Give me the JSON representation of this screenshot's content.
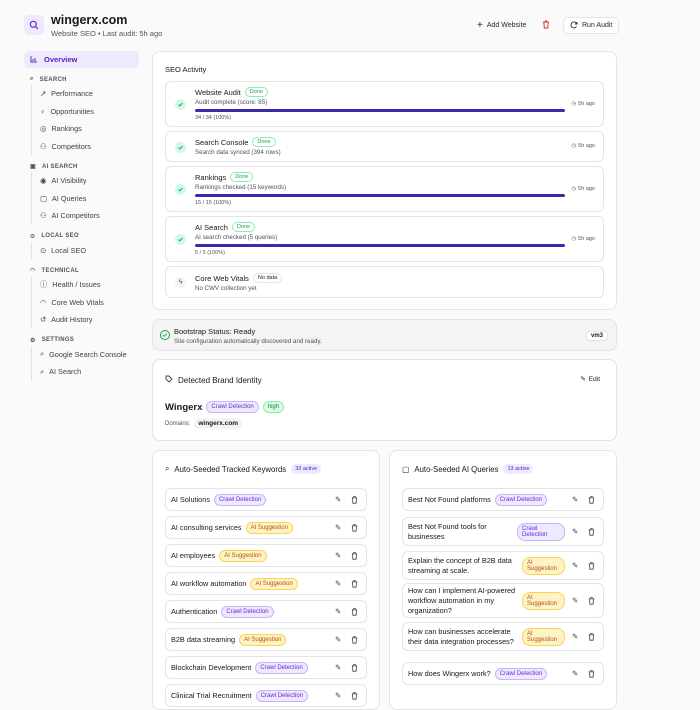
{
  "header": {
    "site": "wingerx.com",
    "subtitle": "Website SEO  • Last audit: 5h ago",
    "add_website": "Add Website",
    "run_audit": "Run Audit"
  },
  "sidebar": {
    "overview": "Overview",
    "sections": [
      {
        "title": "SEARCH",
        "items": [
          "Performance",
          "Opportunities",
          "Rankings",
          "Competitors"
        ]
      },
      {
        "title": "AI SEARCH",
        "items": [
          "AI Visibility",
          "AI Queries",
          "AI Competitors"
        ]
      },
      {
        "title": "LOCAL SEO",
        "items": [
          "Local SEO"
        ]
      },
      {
        "title": "TECHNICAL",
        "items": [
          "Health / Issues",
          "Core Web Vitals",
          "Audit History"
        ]
      },
      {
        "title": "SETTINGS",
        "items": [
          "Google Search Console",
          "AI Search"
        ]
      }
    ]
  },
  "activity": {
    "title": "SEO Activity",
    "items": [
      {
        "name": "Website Audit",
        "status": "Done",
        "desc": "Audit complete (score: 85)",
        "count": "34 / 34 (100%)",
        "time": "5h ago",
        "progress": 1.0
      },
      {
        "name": "Search Console",
        "status": "Done",
        "desc": "Search data synced (394 rows)",
        "time": "5h ago"
      },
      {
        "name": "Rankings",
        "status": "Done",
        "desc": "Rankings checked (15 keywords)",
        "count": "15 / 15 (100%)",
        "time": "5h ago",
        "progress": 1.0
      },
      {
        "name": "AI Search",
        "status": "Done",
        "desc": "AI search checked (5 queries)",
        "count": "5 / 5 (100%)",
        "time": "5h ago",
        "progress": 1.0
      },
      {
        "name": "Core Web Vitals",
        "status": "No data",
        "desc": "No CWV collection yet"
      }
    ]
  },
  "bootstrap": {
    "title": "Bootstrap Status: Ready",
    "desc": "Site configuration automatically discovered and ready.",
    "badge": "vm3"
  },
  "brand": {
    "title": "Detected Brand Identity",
    "edit": "Edit",
    "name": "Wingerx",
    "tag1": "Crawl Detection",
    "tag2": "high",
    "domains_label": "Domains:",
    "domain": "wingerx.com"
  },
  "keywords": {
    "title": "Auto-Seeded Tracked Keywords",
    "count": "33 active",
    "items": [
      {
        "text": "AI Solutions",
        "tag": "Crawl Detection"
      },
      {
        "text": "AI consulting services",
        "tag": "AI Suggestion"
      },
      {
        "text": "AI employees",
        "tag": "AI Suggestion"
      },
      {
        "text": "AI workflow automation",
        "tag": "AI Suggestion"
      },
      {
        "text": "Authentication",
        "tag": "Crawl Detection"
      },
      {
        "text": "B2B data streaming",
        "tag": "AI Suggestion"
      },
      {
        "text": "Blockchain Development",
        "tag": "Crawl Detection"
      },
      {
        "text": "Clinical Trial Recruitment",
        "tag": "Crawl Detection"
      }
    ]
  },
  "queries": {
    "title": "Auto-Seeded AI Queries",
    "count": "13 active",
    "items": [
      {
        "text": "Best Not Found platforms",
        "tag": "Crawl Detection"
      },
      {
        "text": "Best Not Found tools for businesses",
        "tag": "Crawl Detection"
      },
      {
        "text": "Explain the concept of B2B data streaming at scale.",
        "tag": "AI Suggestion"
      },
      {
        "text": "How can I implement AI-powered workflow automation in my organization?",
        "tag": "AI Suggestion"
      },
      {
        "text": "How can businesses accelerate their data integration processes?",
        "tag": "AI Suggestion"
      },
      {
        "text": "How does Wingerx work?",
        "tag": "Crawl Detection"
      }
    ]
  }
}
